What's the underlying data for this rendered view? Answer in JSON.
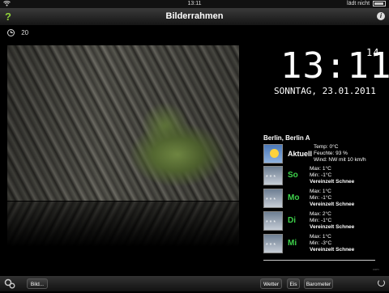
{
  "statusbar": {
    "time": "13:11",
    "battery_label": "lädt nicht"
  },
  "titlebar": {
    "title": "Bilderrahmen",
    "help_glyph": "?",
    "info_glyph": "i"
  },
  "timer": {
    "value": "20"
  },
  "clock": {
    "time": "13:11",
    "seconds": "14",
    "date": "SONNTAG, 23.01.2011"
  },
  "weather": {
    "city": "Berlin, Berlin A",
    "current": {
      "label": "Aktuell",
      "temp": "Temp: 0°C",
      "humidity": "Feuchte: 93 %",
      "wind": "Wind: NW mit 10 km/h"
    },
    "days": [
      {
        "day": "So",
        "max": "Max: 1°C",
        "min": "Min: -1°C",
        "desc": "Vereinzelt Schnee"
      },
      {
        "day": "Mo",
        "max": "Max: 1°C",
        "min": "Min: -1°C",
        "desc": "Vereinzelt Schnee"
      },
      {
        "day": "Di",
        "max": "Max: 2°C",
        "min": "Min: -1°C",
        "desc": "Vereinzelt Schnee"
      },
      {
        "day": "Mi",
        "max": "Max: 1°C",
        "min": "Min: -3°C",
        "desc": "Vereinzelt Schnee"
      }
    ],
    "footer": "com"
  },
  "toolbar": {
    "bild": "Bild...",
    "wetter": "Wetter",
    "eis": "Eis",
    "barometer": "Barometer"
  },
  "colors": {
    "day_green": "#3ed24b",
    "help_green": "#8fd13a"
  }
}
